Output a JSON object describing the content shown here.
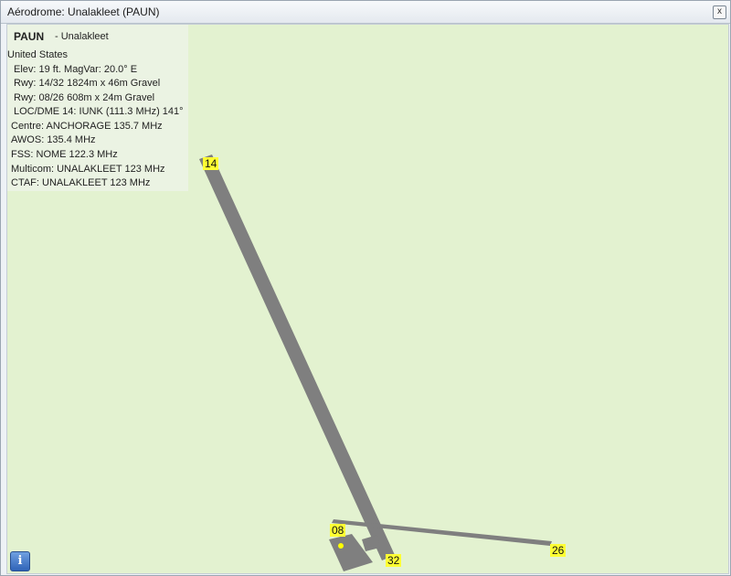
{
  "window": {
    "title": "Aérodrome: Unalakleet (PAUN)",
    "close_label": "x"
  },
  "info": {
    "code": "PAUN",
    "name": "- Unalakleet",
    "country": "United States",
    "lines": [
      "Elev: 19 ft. MagVar: 20.0° E",
      "Rwy: 14/32 1824m x 46m Gravel",
      "Rwy: 08/26 608m x 24m Gravel",
      "LOC/DME 14: IUNK (111.3 MHz) 141°",
      "Centre: ANCHORAGE 135.7 MHz",
      "AWOS:  135.4 MHz",
      "FSS: NOME 122.3 MHz",
      "Multicom: UNALAKLEET 123 MHz",
      "CTAF: UNALAKLEET 123 MHz"
    ]
  },
  "runways": {
    "labels": [
      "14",
      "32",
      "08",
      "26"
    ]
  },
  "colors": {
    "map_bg": "#e3f2d0",
    "runway": "#7f7f7f",
    "label_bg": "#ffff33",
    "marker": "#ffff00"
  },
  "icons": {
    "info": "info-icon",
    "info_glyph": "i"
  }
}
